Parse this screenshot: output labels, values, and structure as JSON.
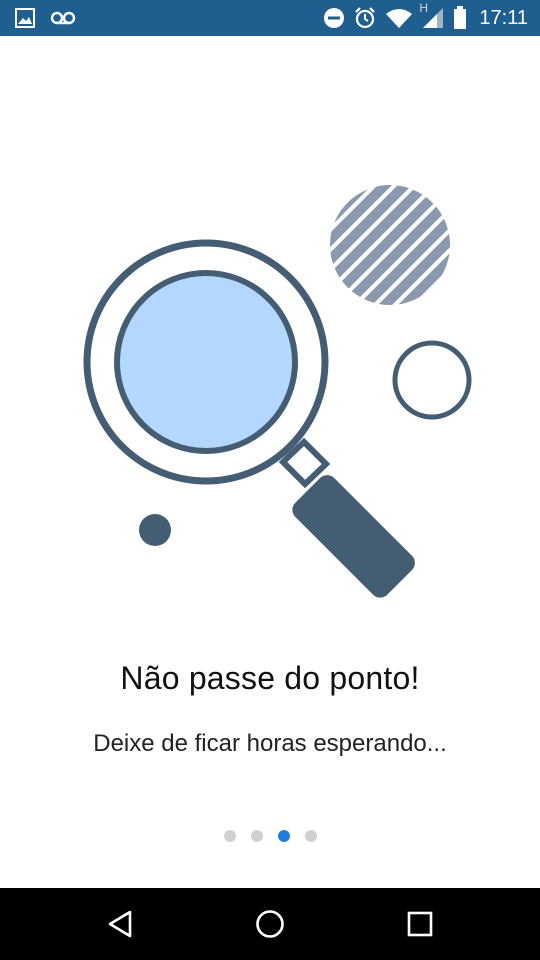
{
  "status_bar": {
    "time": "17:11",
    "network_label": "H",
    "background_color": "#1f5f8f",
    "left_icons": [
      "image-icon",
      "voicemail-icon"
    ],
    "right_icons": [
      "do-not-disturb-icon",
      "alarm-icon",
      "wifi-icon",
      "signal-icon",
      "battery-icon"
    ]
  },
  "onboarding": {
    "illustration": "magnifying-glass-icon",
    "title": "Não passe do ponto!",
    "subtitle": "Deixe de ficar horas esperando...",
    "pager": {
      "total": 4,
      "active_index": 2,
      "active_color": "#1e7fe0",
      "inactive_color": "#d0d0d0"
    }
  },
  "nav_bar": {
    "buttons": [
      "back-icon",
      "home-icon",
      "recents-icon"
    ]
  },
  "colors": {
    "illustration_dark": "#445d73",
    "lens_fill": "#b3d7fd",
    "stripes": "#8a99ad"
  }
}
